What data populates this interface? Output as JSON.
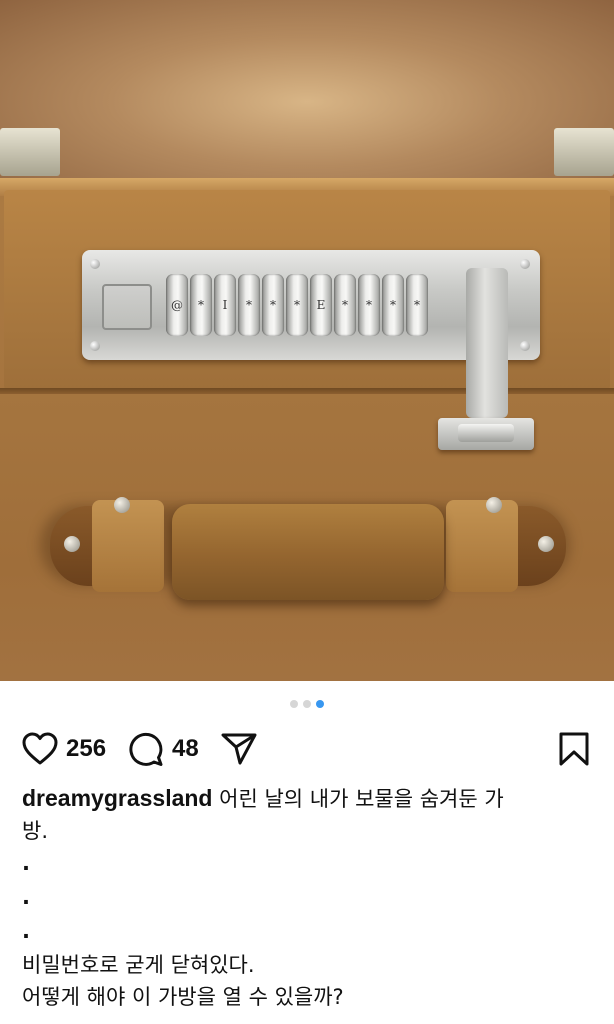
{
  "post": {
    "image": {
      "description_icon": "locked-suitcase-photo",
      "lock_wheels": [
        "@",
        "*",
        "I",
        "*",
        "*",
        "*",
        "E",
        "*",
        "*",
        "*",
        "*"
      ]
    },
    "carousel": {
      "count": 3,
      "active_index": 2,
      "active_color": "#3897f0",
      "inactive_color": "#d6d6d6"
    },
    "actions": {
      "like": {
        "icon": "heart-icon",
        "count": "256"
      },
      "comment": {
        "icon": "comment-icon",
        "count": "48"
      },
      "share": {
        "icon": "paper-plane-icon"
      },
      "save": {
        "icon": "bookmark-icon"
      }
    },
    "caption": {
      "username": "dreamygrassland",
      "first_line_text": " 어린 날의 내가 보물을 숨겨둔 가",
      "second_line_text": "방.",
      "dots": [
        ".",
        ".",
        "."
      ],
      "line_3": "비밀번호로 굳게 닫혀있다.",
      "line_4": "어떻게 해야 이 가방을 열 수 있을까?"
    }
  }
}
